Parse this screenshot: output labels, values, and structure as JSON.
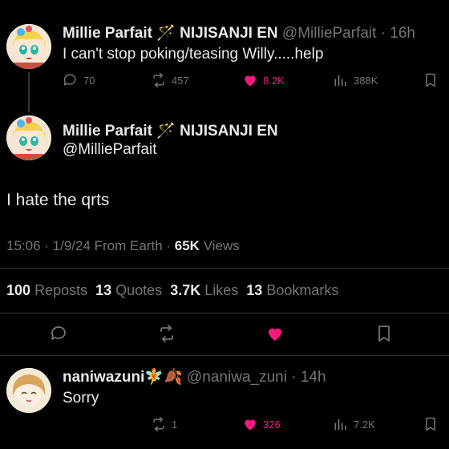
{
  "colors": {
    "bg": "#000000",
    "text": "#e7e9ea",
    "muted": "#71767b",
    "like": "#f91880",
    "border": "#2f3336"
  },
  "parent_tweet": {
    "display_name": "Millie Parfait",
    "wand": "🪄",
    "org": "NIJISANJI EN",
    "handle": "@MillieParfait",
    "time": "16h",
    "text": "I can't stop poking/teasing Willy.....help",
    "replies": "70",
    "reposts": "457",
    "likes": "8.2K",
    "views": "388K",
    "liked": true
  },
  "main_tweet": {
    "display_name": "Millie Parfait",
    "wand": "🪄",
    "org": "NIJISANJI EN",
    "handle": "@MillieParfait",
    "text": "I hate the qrts",
    "timestamp": "15:06 · 1/9/24 From Earth",
    "views_count": "65K",
    "views_label": "Views",
    "stats": [
      {
        "count": "100",
        "label": "Reposts"
      },
      {
        "count": "13",
        "label": "Quotes"
      },
      {
        "count": "3.7K",
        "label": "Likes"
      },
      {
        "count": "13",
        "label": "Bookmarks"
      }
    ],
    "liked": true
  },
  "reply_tweet": {
    "display_name": "naniwazuni",
    "emojis": "🧚🍂",
    "handle": "@naniwa_zuni",
    "time": "14h",
    "text": "Sorry",
    "reposts": "1",
    "likes": "326",
    "views": "7.2K",
    "liked": true
  },
  "icons": [
    "reply-icon",
    "repost-icon",
    "like-icon",
    "views-icon",
    "bookmark-icon"
  ]
}
